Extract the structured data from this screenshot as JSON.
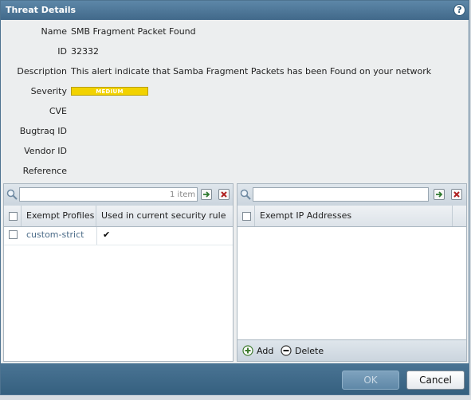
{
  "dialog": {
    "title": "Threat Details",
    "help_icon": "?"
  },
  "details": {
    "name_label": "Name",
    "name_value": "SMB Fragment Packet Found",
    "id_label": "ID",
    "id_value": "32332",
    "description_label": "Description",
    "description_value": "This alert indicate that Samba Fragment Packets has been Found on your network",
    "severity_label": "Severity",
    "severity_value": "MEDIUM",
    "cve_label": "CVE",
    "bugtraq_label": "Bugtraq ID",
    "vendor_label": "Vendor ID",
    "reference_label": "Reference"
  },
  "left_panel": {
    "search_placeholder": "",
    "item_count": "1 item",
    "columns": [
      "Exempt Profiles",
      "Used in current security rule"
    ],
    "rows": [
      {
        "profile": "custom-strict",
        "used": "✔"
      }
    ]
  },
  "right_panel": {
    "search_placeholder": "",
    "columns": [
      "Exempt IP Addresses"
    ],
    "add_label": "Add",
    "delete_label": "Delete"
  },
  "footer": {
    "ok_label": "OK",
    "cancel_label": "Cancel"
  },
  "colors": {
    "header": "#41698a",
    "severity_medium": "#f2d200",
    "link": "#4b6b88"
  },
  "icons": {
    "help": "help-icon",
    "search": "search-icon",
    "apply": "arrow-right-icon",
    "clear": "clear-x-icon",
    "add": "plus-icon",
    "delete": "minus-icon"
  }
}
